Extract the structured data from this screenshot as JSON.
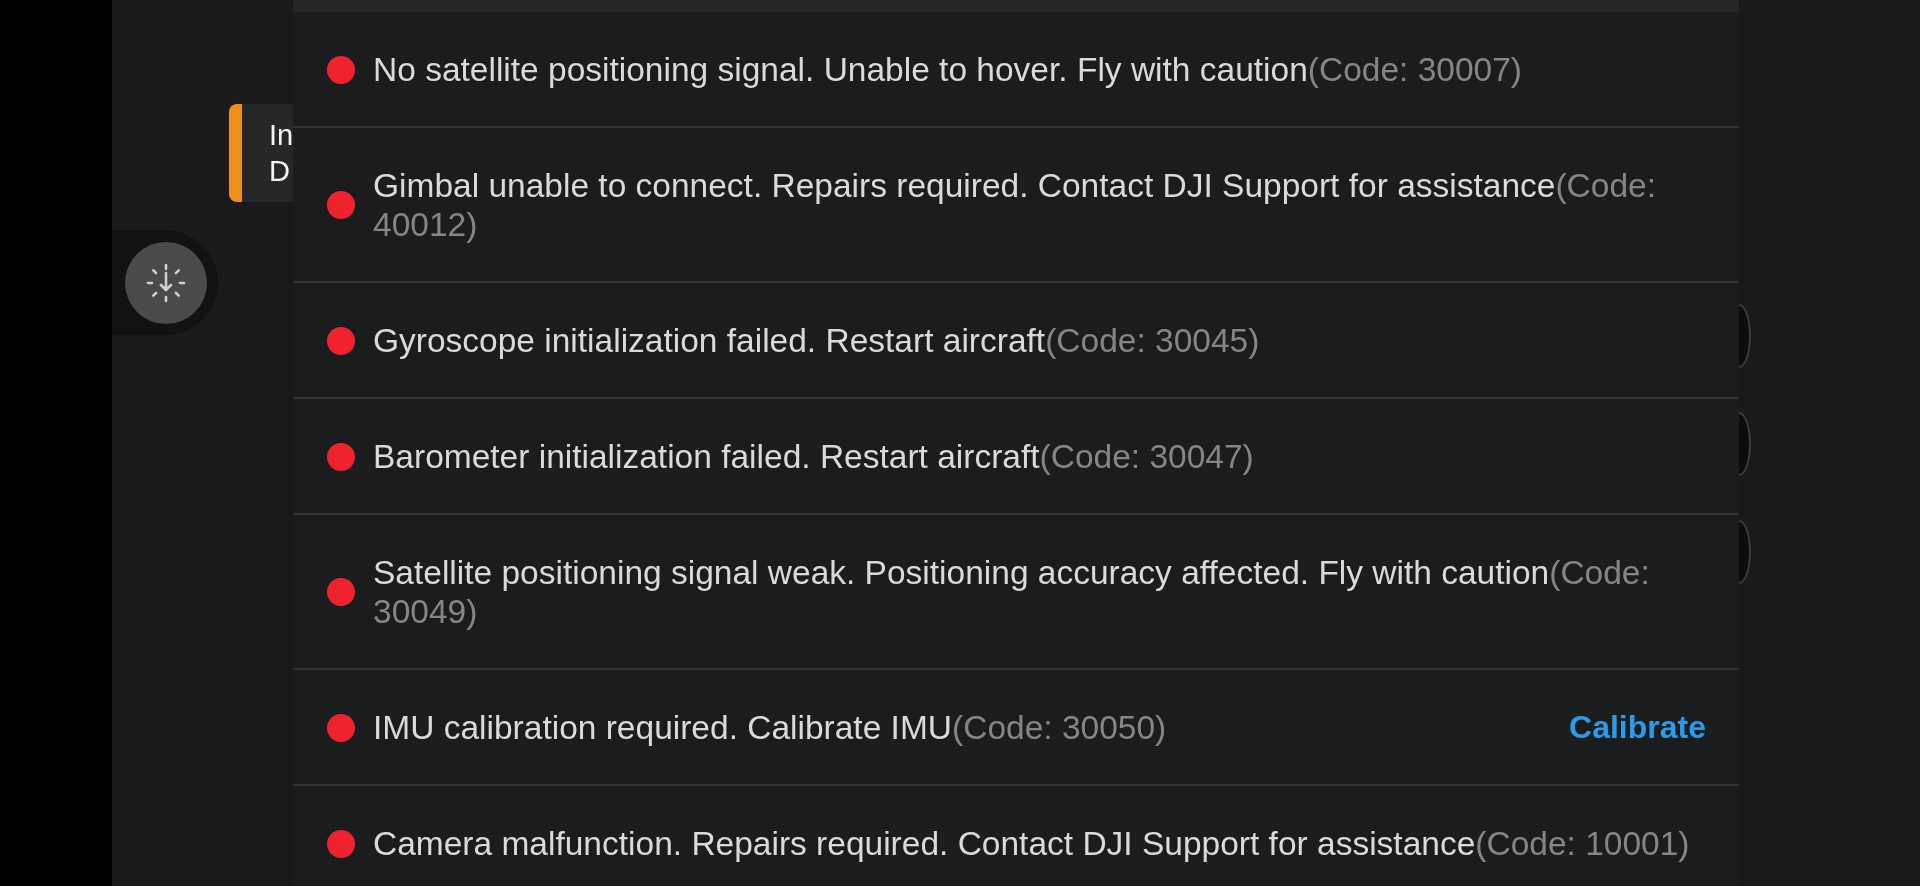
{
  "toast": {
    "message": "In D"
  },
  "errors": [
    {
      "message": "No satellite positioning signal. Unable to hover. Fly with caution",
      "code": "(Code: 30007)"
    },
    {
      "message": "Gimbal unable to connect. Repairs required. Contact DJI Support for assistance",
      "code": "(Code: 40012)"
    },
    {
      "message": "Gyroscope initialization failed. Restart aircraft",
      "code": "(Code: 30045)"
    },
    {
      "message": "Barometer initialization failed. Restart aircraft",
      "code": "(Code: 30047)"
    },
    {
      "message": "Satellite positioning signal weak. Positioning accuracy affected. Fly with caution",
      "code": "(Code: 30049)"
    },
    {
      "message": "IMU calibration required. Calibrate IMU",
      "code": "(Code: 30050)",
      "action": "Calibrate"
    },
    {
      "message": "Camera malfunction. Repairs required. Contact DJI Support for assistance",
      "code": "(Code: 10001)"
    }
  ]
}
